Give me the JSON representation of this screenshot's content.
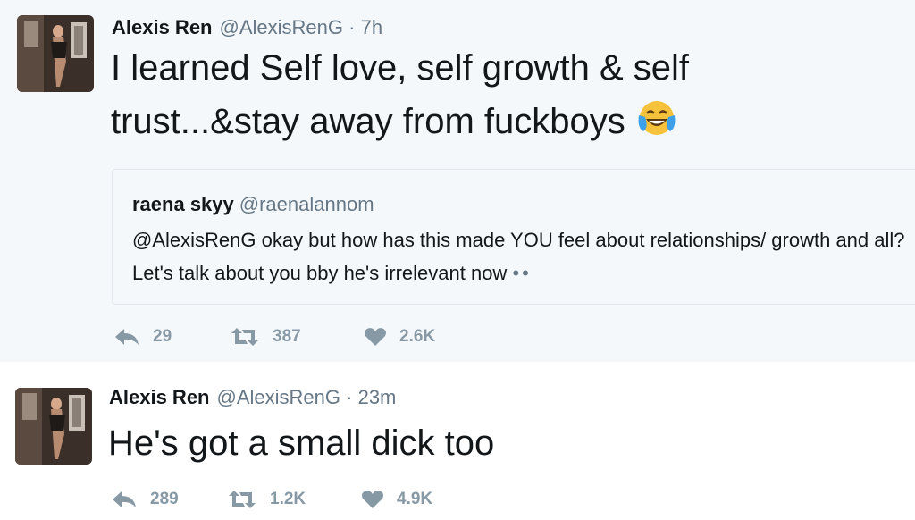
{
  "tweets": [
    {
      "name": "Alexis Ren",
      "handle": "@AlexisRenG",
      "separator": "·",
      "time": "7h",
      "text_line1": "I learned Self love, self growth & self",
      "text_line2": "trust...&stay away from fuckboys",
      "emoji": "face-with-tears-of-joy",
      "quoted": {
        "name": "raena skyy",
        "handle": "@raenalannom",
        "text": "@AlexisRenG okay but how has this made YOU feel about relationships/ growth and all? Let's talk about you bby he's irrelevant now",
        "trailing": "••"
      },
      "actions": {
        "reply": "29",
        "retweet": "387",
        "like": "2.6K"
      }
    },
    {
      "name": "Alexis Ren",
      "handle": "@AlexisRenG",
      "separator": "·",
      "time": "23m",
      "text": "He's got a small dick too",
      "actions": {
        "reply": "289",
        "retweet": "1.2K",
        "like": "4.9K"
      }
    }
  ],
  "colors": {
    "text": "#14171a",
    "secondary": "#657786",
    "actions": "#8899a6",
    "bg_first": "#f5f8fa",
    "divider": "#e1e8ed"
  }
}
